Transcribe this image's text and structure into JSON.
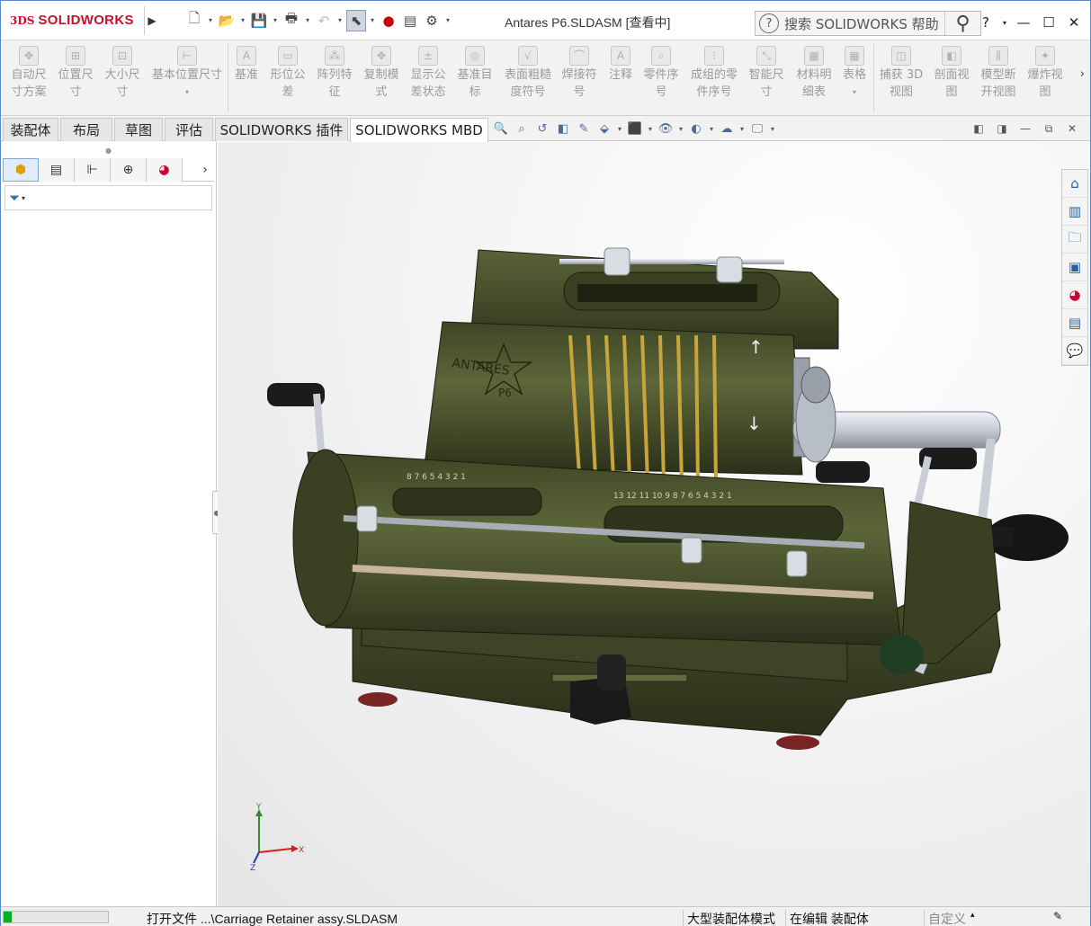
{
  "app": {
    "brand_prefix": "3DS",
    "brand_name": "SOLIDWORKS",
    "document_title": "Antares P6.SLDASM [查看中]",
    "search_placeholder": "搜索 SOLIDWORKS 帮助"
  },
  "quick_access": [
    "new-icon",
    "open-icon",
    "save-icon",
    "print-icon",
    "undo-icon",
    "select-icon",
    "rebuild-icon",
    "file-properties-icon",
    "options-icon"
  ],
  "window_controls": {
    "help": "?",
    "minimize": "—",
    "maximize": "☐",
    "close": "✕"
  },
  "ribbon": {
    "items": [
      {
        "label": "自动尺寸方案",
        "l1": "自动尺",
        "l2": "寸方案"
      },
      {
        "label": "位置尺寸",
        "l1": "位置尺",
        "l2": "寸"
      },
      {
        "label": "大小尺寸",
        "l1": "大小尺",
        "l2": "寸"
      },
      {
        "label": "基本位置尺寸",
        "l1": "基本位置尺寸",
        "l2": ""
      },
      {
        "label": "基准",
        "l1": "基准",
        "l2": ""
      },
      {
        "label": "形位公差",
        "l1": "形位公",
        "l2": "差"
      },
      {
        "label": "阵列特征",
        "l1": "阵列特",
        "l2": "征"
      },
      {
        "label": "复制模式",
        "l1": "复制模",
        "l2": "式"
      },
      {
        "label": "显示公差状态",
        "l1": "显示公",
        "l2": "差状态"
      },
      {
        "label": "基准目标",
        "l1": "基准目",
        "l2": "标"
      },
      {
        "label": "表面粗糙度符号",
        "l1": "表面粗糙",
        "l2": "度符号"
      },
      {
        "label": "焊接符号",
        "l1": "焊接符",
        "l2": "号"
      },
      {
        "label": "注释",
        "l1": "注释",
        "l2": ""
      },
      {
        "label": "零件序号",
        "l1": "零件序",
        "l2": "号"
      },
      {
        "label": "成组的零件序号",
        "l1": "成组的零",
        "l2": "件序号"
      },
      {
        "label": "智能尺寸",
        "l1": "智能尺",
        "l2": "寸"
      },
      {
        "label": "材料明细表",
        "l1": "材料明",
        "l2": "细表"
      },
      {
        "label": "表格",
        "l1": "表格",
        "l2": ""
      },
      {
        "label": "捕获 3D 视图",
        "l1": "捕获 3D",
        "l2": "视图"
      },
      {
        "label": "剖面视图",
        "l1": "剖面视",
        "l2": "图"
      },
      {
        "label": "模型断开视图",
        "l1": "模型断",
        "l2": "开视图"
      },
      {
        "label": "爆炸视图",
        "l1": "爆炸视",
        "l2": "图"
      }
    ]
  },
  "tabs": [
    {
      "label": "装配体",
      "active": false
    },
    {
      "label": "布局",
      "active": false
    },
    {
      "label": "草图",
      "active": false
    },
    {
      "label": "评估",
      "active": false
    },
    {
      "label": "SOLIDWORKS 插件",
      "active": false
    },
    {
      "label": "SOLIDWORKS MBD",
      "active": true
    }
  ],
  "model_text": {
    "brand": "ANTARES",
    "model": "P6",
    "carriage_digits_top": "9 8 7 6 5 4 3 2 1",
    "carriage_left_digits": "8 7 6 5 4 3 2 1",
    "carriage_right_digits": "13 12 11 10 9 8 7 6 5 4 3 2 1"
  },
  "axes": {
    "x": "X",
    "y": "Y",
    "z": "Z"
  },
  "statusbar": {
    "progress_fraction": 0.08,
    "message": "打开文件 ...\\Carriage Retainer assy.SLDASM",
    "mode": "大型装配体模式",
    "editing": "在编辑 装配体",
    "custom": "自定义"
  },
  "colors": {
    "accent": "#c8102e",
    "body": "#4a5230",
    "progress": "#06b025",
    "panel": "#f2f2f2"
  }
}
